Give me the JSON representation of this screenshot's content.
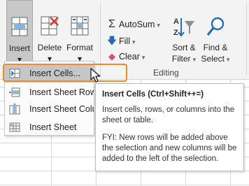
{
  "ribbon": {
    "insert_label": "Insert",
    "delete_label": "Delete",
    "format_label": "Format",
    "autosum_label": "AutoSum",
    "fill_label": "Fill",
    "clear_label": "Clear",
    "sort_filter_line1": "Sort &",
    "sort_filter_line2": "Filter",
    "find_select_line1": "Find &",
    "find_select_line2": "Select",
    "editing_group_label": "Editing"
  },
  "menu": {
    "items": [
      {
        "label": "Insert Cells...",
        "icon": "insert-cells-icon",
        "highlighted": true
      },
      {
        "label": "Insert Sheet Rows",
        "icon": "insert-rows-icon",
        "highlighted": false
      },
      {
        "label": "Insert Sheet Columns",
        "icon": "insert-columns-icon",
        "highlighted": false
      },
      {
        "label": "Insert Sheet",
        "icon": "insert-sheet-icon",
        "highlighted": false
      }
    ]
  },
  "tooltip": {
    "title": "Insert Cells (Ctrl+Shift++=)",
    "description": "Insert cells, rows, or columns into the sheet or table.",
    "fyi": "FYI: New rows will be added above the selection and new columns will be added to the left of the selection."
  },
  "colors": {
    "highlight_border": "#ee8a2d",
    "ribbon_bg": "#f3f3f3",
    "pressed_bg": "#c8c8c8",
    "accent_blue": "#2b6cb0"
  }
}
